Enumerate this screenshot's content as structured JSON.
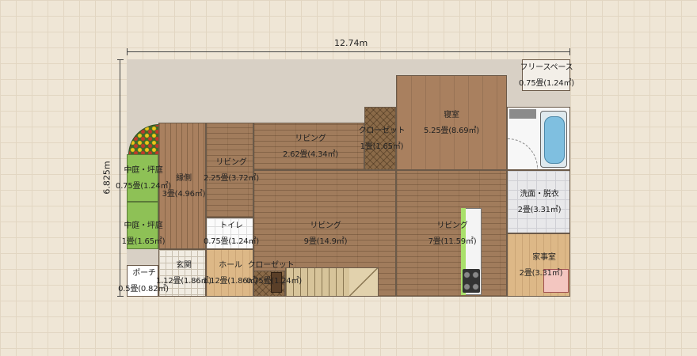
{
  "dimensions": {
    "width_label": "12.74m",
    "height_label": "6.825m"
  },
  "rooms": {
    "free_space": {
      "name": "フリースペース",
      "area": "0.75畳(1.24㎡)"
    },
    "bedroom": {
      "name": "寝室",
      "area": "5.25畳(8.69㎡)"
    },
    "closet_upper": {
      "name": "クローゼット",
      "area": "1畳(1.65㎡)"
    },
    "living_upper": {
      "name": "リビング",
      "area": "2.62畳(4.34㎡)"
    },
    "living_left": {
      "name": "リビング",
      "area": "2.25畳(3.72㎡)"
    },
    "engawa": {
      "name": "縁側",
      "area": "3畳(4.96㎡)"
    },
    "courtyard_1": {
      "name": "中庭・坪庭",
      "area": "0.75畳(1.24㎡)"
    },
    "courtyard_2": {
      "name": "中庭・坪庭",
      "area": "1畳(1.65㎡)"
    },
    "toilet": {
      "name": "トイレ",
      "area": "0.75畳(1.24㎡)"
    },
    "living_center": {
      "name": "リビング",
      "area": "9畳(14.9㎡)"
    },
    "living_right": {
      "name": "リビング",
      "area": "7畳(11.59㎡)"
    },
    "washroom": {
      "name": "洗面・脱衣",
      "area": "2畳(3.31㎡)"
    },
    "housework": {
      "name": "家事室",
      "area": "2畳(3.31㎡)"
    },
    "porch": {
      "name": "ポーチ",
      "area": "0.5畳(0.82㎡)"
    },
    "entrance": {
      "name": "玄関",
      "area": "1.12畳(1.86㎡)"
    },
    "hall": {
      "name": "ホール",
      "area": "1.12畳(1.86㎡)"
    },
    "closet_lower": {
      "name": "クローゼット",
      "area": "0.75畳(1.24㎡)"
    }
  },
  "colors": {
    "wood": "#a17c5c",
    "green": "#8ec156",
    "outline": "#6b5a49",
    "bath": "#7fbfe0"
  },
  "icons": [
    "plant-icon",
    "bathtub-icon",
    "toilet-icon",
    "stove-icon",
    "sink-icon",
    "stairs-icon",
    "bed-icon"
  ]
}
